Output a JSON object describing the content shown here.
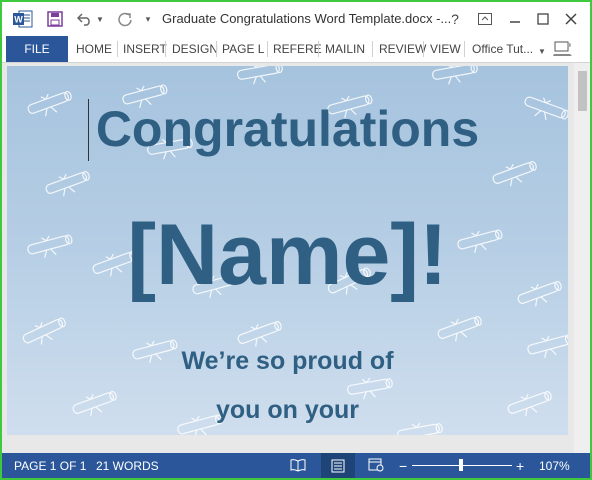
{
  "titlebar": {
    "title": "Graduate Congratulations Word Template.docx -...",
    "help_label": "?"
  },
  "ribbon": {
    "file_label": "FILE",
    "tabs": [
      "HOME",
      "INSERT",
      "DESIGN",
      "PAGE L",
      "REFERE",
      "MAILIN",
      "REVIEW",
      "VIEW"
    ],
    "account_label": "Office Tut..."
  },
  "document": {
    "heading": "Congratulations",
    "name": "[Name]!",
    "line1": "We’re so proud of",
    "line2": "you on your"
  },
  "statusbar": {
    "page": "PAGE 1 OF 1",
    "words": "21 WORDS",
    "zoom_minus": "−",
    "zoom_plus": "+",
    "zoom": "107%"
  },
  "colors": {
    "accent": "#2b579a",
    "heading_text": "#2f5f82",
    "window_border": "#3ec93e"
  }
}
